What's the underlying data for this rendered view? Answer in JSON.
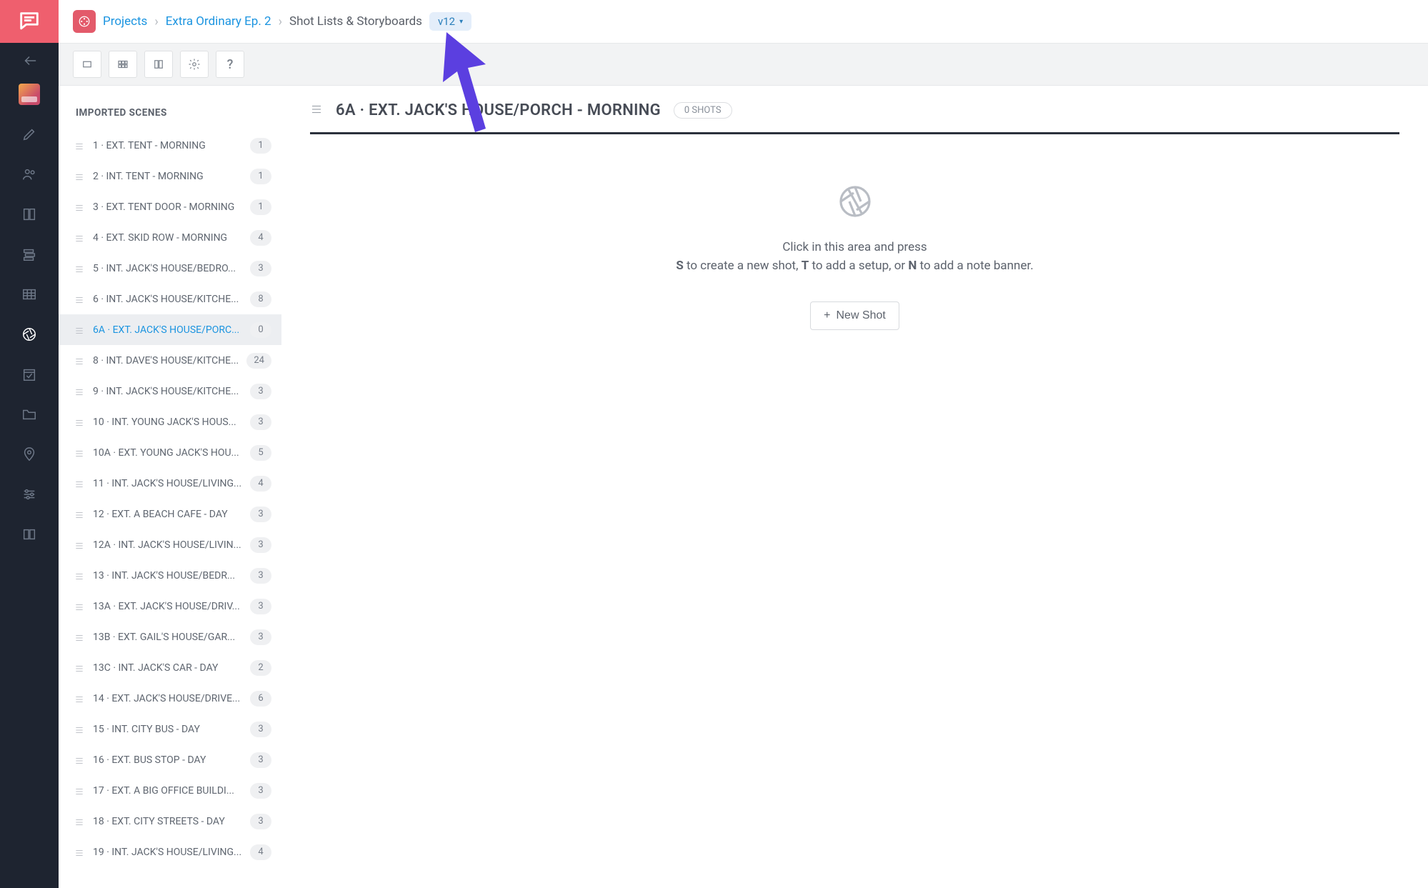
{
  "breadcrumb": {
    "projects": "Projects",
    "project_name": "Extra Ordinary Ep. 2",
    "section": "Shot Lists & Storyboards",
    "version": "v12"
  },
  "sidebar": {
    "title": "IMPORTED SCENES",
    "scenes": [
      {
        "label": "1 · EXT. TENT - MORNING",
        "count": 1,
        "active": false
      },
      {
        "label": "2 · INT. TENT - MORNING",
        "count": 1,
        "active": false
      },
      {
        "label": "3 · EXT. TENT DOOR - MORNING",
        "count": 1,
        "active": false
      },
      {
        "label": "4 · EXT. SKID ROW - MORNING",
        "count": 4,
        "active": false
      },
      {
        "label": "5 · INT. JACK'S HOUSE/BEDRO...",
        "count": 3,
        "active": false
      },
      {
        "label": "6 · INT. JACK'S HOUSE/KITCHE...",
        "count": 8,
        "active": false
      },
      {
        "label": "6A · EXT. JACK'S HOUSE/PORC...",
        "count": 0,
        "active": true
      },
      {
        "label": "8 · INT. DAVE'S HOUSE/KITCHE...",
        "count": 24,
        "active": false
      },
      {
        "label": "9 · INT. JACK'S HOUSE/KITCHE...",
        "count": 3,
        "active": false
      },
      {
        "label": "10 · INT. YOUNG JACK'S HOUS...",
        "count": 3,
        "active": false
      },
      {
        "label": "10A · EXT. YOUNG JACK'S HOU...",
        "count": 5,
        "active": false
      },
      {
        "label": "11 · INT. JACK'S HOUSE/LIVING...",
        "count": 4,
        "active": false
      },
      {
        "label": "12 · EXT. A BEACH CAFE - DAY",
        "count": 3,
        "active": false
      },
      {
        "label": "12A · INT. JACK'S HOUSE/LIVIN...",
        "count": 3,
        "active": false
      },
      {
        "label": "13 · INT. JACK'S HOUSE/BEDR...",
        "count": 3,
        "active": false
      },
      {
        "label": "13A · EXT. JACK'S HOUSE/DRIV...",
        "count": 3,
        "active": false
      },
      {
        "label": "13B · EXT. GAIL'S HOUSE/GAR...",
        "count": 3,
        "active": false
      },
      {
        "label": "13C · INT. JACK'S CAR - DAY",
        "count": 2,
        "active": false
      },
      {
        "label": "14 · EXT. JACK'S HOUSE/DRIVE...",
        "count": 6,
        "active": false
      },
      {
        "label": "15 · INT. CITY BUS - DAY",
        "count": 3,
        "active": false
      },
      {
        "label": "16 · EXT. BUS STOP - DAY",
        "count": 3,
        "active": false
      },
      {
        "label": "17 · EXT. A BIG OFFICE BUILDI...",
        "count": 3,
        "active": false
      },
      {
        "label": "18 · EXT. CITY STREETS - DAY",
        "count": 3,
        "active": false
      },
      {
        "label": "19 · INT. JACK'S HOUSE/LIVING...",
        "count": 4,
        "active": false
      }
    ]
  },
  "main": {
    "scene_title": "6A · EXT. JACK'S HOUSE/PORCH - MORNING",
    "shot_count_label": "0 SHOTS",
    "empty_line1": "Click in this area and press",
    "empty_line2_pre": "",
    "empty_s": "S",
    "empty_line2_mid1": " to create a new shot, ",
    "empty_t": "T",
    "empty_line2_mid2": " to add a setup, or ",
    "empty_n": "N",
    "empty_line2_post": " to add a note banner.",
    "new_shot_label": "New Shot"
  }
}
